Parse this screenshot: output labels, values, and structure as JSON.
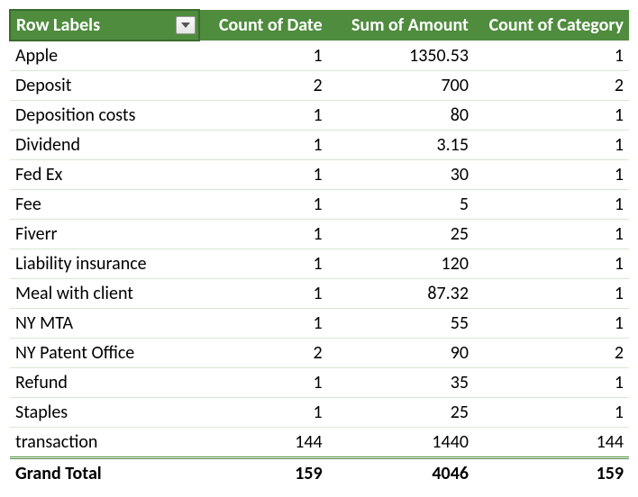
{
  "colors": {
    "headerBg": "#4F8C3E",
    "gridline": "#d6e8cf"
  },
  "headers": {
    "rowLabels": "Row Labels",
    "countDate": "Count of Date",
    "sumAmount": "Sum of Amount",
    "countCategory": "Count of Category"
  },
  "rows": [
    {
      "label": "Apple",
      "countDate": "1",
      "sumAmount": "1350.53",
      "countCategory": "1"
    },
    {
      "label": "Deposit",
      "countDate": "2",
      "sumAmount": "700",
      "countCategory": "2"
    },
    {
      "label": "Deposition costs",
      "countDate": "1",
      "sumAmount": "80",
      "countCategory": "1"
    },
    {
      "label": "Dividend",
      "countDate": "1",
      "sumAmount": "3.15",
      "countCategory": "1"
    },
    {
      "label": "Fed Ex",
      "countDate": "1",
      "sumAmount": "30",
      "countCategory": "1"
    },
    {
      "label": "Fee",
      "countDate": "1",
      "sumAmount": "5",
      "countCategory": "1"
    },
    {
      "label": "Fiverr",
      "countDate": "1",
      "sumAmount": "25",
      "countCategory": "1"
    },
    {
      "label": "Liability insurance",
      "countDate": "1",
      "sumAmount": "120",
      "countCategory": "1"
    },
    {
      "label": "Meal with client",
      "countDate": "1",
      "sumAmount": "87.32",
      "countCategory": "1"
    },
    {
      "label": "NY MTA",
      "countDate": "1",
      "sumAmount": "55",
      "countCategory": "1"
    },
    {
      "label": "NY Patent Office",
      "countDate": "2",
      "sumAmount": "90",
      "countCategory": "2"
    },
    {
      "label": "Refund",
      "countDate": "1",
      "sumAmount": "35",
      "countCategory": "1"
    },
    {
      "label": "Staples",
      "countDate": "1",
      "sumAmount": "25",
      "countCategory": "1"
    },
    {
      "label": "transaction",
      "countDate": "144",
      "sumAmount": "1440",
      "countCategory": "144"
    }
  ],
  "total": {
    "label": "Grand Total",
    "countDate": "159",
    "sumAmount": "4046",
    "countCategory": "159"
  }
}
